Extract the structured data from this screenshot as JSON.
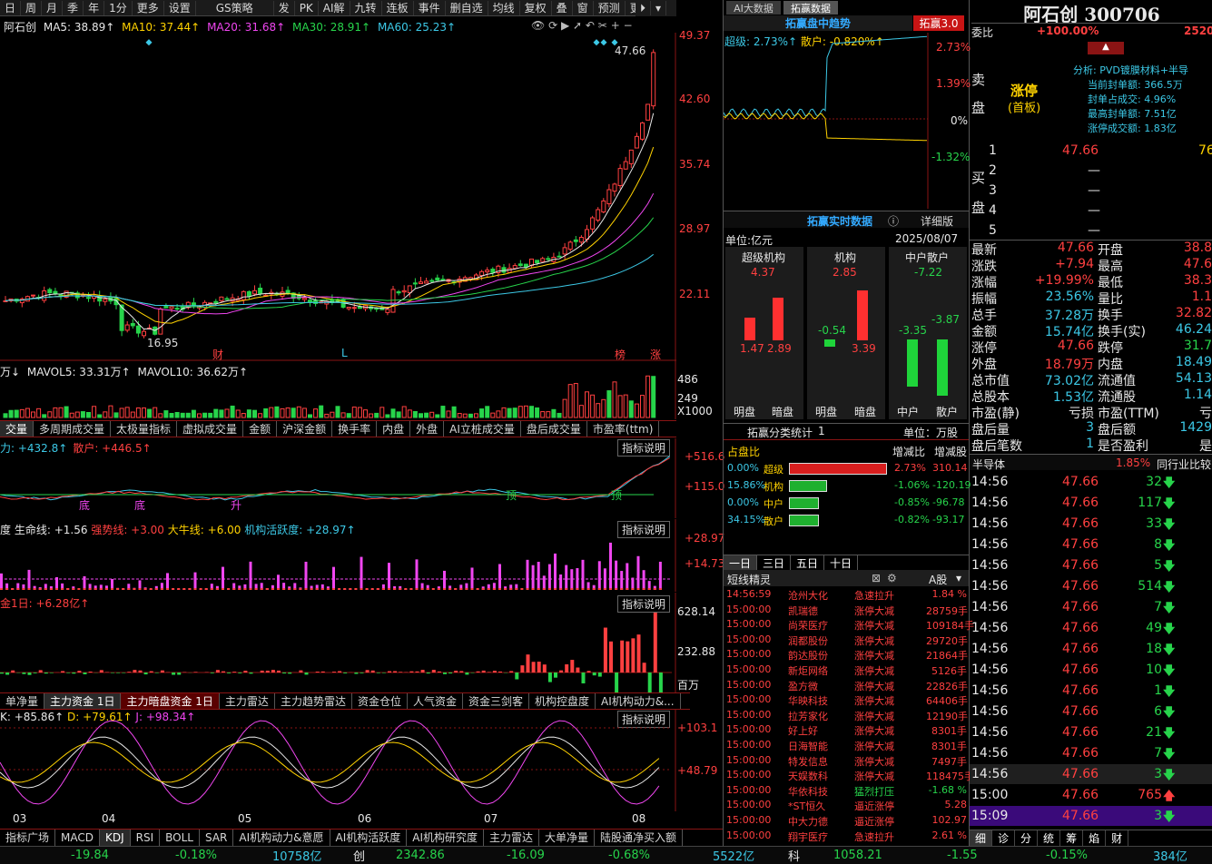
{
  "toolbar": {
    "items": [
      "日",
      "周",
      "月",
      "季",
      "年",
      "1分",
      "更多",
      "设置",
      "GS策略",
      "发",
      "PK",
      "AI解",
      "九转",
      "连板",
      "事件",
      "删自选",
      "均线",
      "复权",
      "叠",
      "窗",
      "预测",
      "更多"
    ]
  },
  "ma_line": {
    "name": "阿石创",
    "ma5": "MA5: 38.89↑",
    "ma10": "MA10: 37.44↑",
    "ma20": "MA20: 31.68↑",
    "ma30": "MA30: 28.91↑",
    "ma60": "MA60: 25.23↑"
  },
  "price_axis": [
    "49.37",
    "42.60",
    "35.74",
    "28.97",
    "22.11"
  ],
  "price_marks": {
    "high": "47.66",
    "low": "16.95",
    "marks": [
      "财",
      "L",
      "榜",
      "涨"
    ]
  },
  "vol": {
    "title": "万↓",
    "mavol5": "MAVOL5: 33.31万↑",
    "mavol10": "MAVOL10: 36.62万↑",
    "axis": [
      "486",
      "249",
      "X1000"
    ]
  },
  "tabs1": [
    "交量",
    "多周期成交量",
    "太极量指标",
    "虚拟成交量",
    "金额",
    "沪深金额",
    "换手率",
    "内盘",
    "外盘",
    "AI立桩成交量",
    "盘后成交量",
    "市盈率(ttm)"
  ],
  "ind1": {
    "text_a": "力: +432.8↑",
    "text_b": "散户: +446.5↑",
    "btn": "指标说明",
    "axis": [
      "+516.6",
      "+115.0"
    ],
    "marks": [
      "底",
      "底",
      "升",
      "顶",
      "顶"
    ]
  },
  "ind2": {
    "label_a": "度",
    "label_b": "生命线: +1.56",
    "label_c": "强势线: +3.00",
    "label_d": "大牛线: +6.00",
    "label_e": "机构活跃度: +28.97↑",
    "btn": "指标说明",
    "axis": [
      "+28.97",
      "+14.73"
    ]
  },
  "ind3": {
    "label": "金1日: +6.28亿↑",
    "btn": "指标说明",
    "axis": [
      "628.14",
      "232.88",
      "百万"
    ]
  },
  "tabs2": [
    "单净量",
    "主力资金 1日",
    "主力暗盘资金 1日",
    "主力雷达",
    "主力趋势雷达",
    "资金仓位",
    "人气资金",
    "资金三剑客",
    "机构控盘度",
    "AI机构动力&..."
  ],
  "kdj": {
    "k": "K: +85.86↑",
    "d": "D: +79.61↑",
    "j": "J: +98.34↑",
    "btn": "指标说明",
    "axis": [
      "+103.1",
      "+48.79"
    ]
  },
  "months": [
    "03",
    "04",
    "05",
    "06",
    "07",
    "08"
  ],
  "tabs3": [
    "指标广场",
    "MACD",
    "KDJ",
    "RSI",
    "BOLL",
    "SAR",
    "AI机构动力&意愿",
    "AI机构活跃度",
    "AI机构研究度",
    "主力雷达",
    "大单净量",
    "陆股通净买入额"
  ],
  "status": {
    "v1": "-19.84",
    "v2": "-0.18%",
    "v3": "10758亿",
    "chuang": "创",
    "c1": "2342.86",
    "c2": "-16.09",
    "c3": "-0.68%",
    "c4": "5522亿",
    "ke": "科",
    "k1": "1058.21",
    "k2": "-1.55",
    "k3": "-0.15%",
    "k4": "384亿"
  },
  "mid": {
    "tab1": "AI大数据",
    "tab2": "拓赢数据",
    "title": "拓赢盘中趋势",
    "badge": "拓赢3.0",
    "super": "超级: 2.73%↑",
    "retail": "散户: -0.820%↑",
    "axis": [
      "2.73%",
      "1.39%",
      "0%",
      "-1.32%"
    ],
    "rt_title": "拓赢实时数据",
    "detail": "详细版",
    "unit": "单位:亿元",
    "date": "2025/08/07",
    "groups": [
      {
        "name": "超级机构",
        "total": "4.37",
        "a": "1.47",
        "b": "2.89"
      },
      {
        "name": "机构",
        "total": "2.85",
        "a": "-0.54",
        "b": "3.39"
      },
      {
        "name": "中户散户",
        "total": "-7.22",
        "a": "-3.35",
        "b": "-3.87"
      }
    ],
    "bar_labels": [
      "明盘",
      "暗盘",
      "明盘",
      "暗盘",
      "中户",
      "散户"
    ],
    "cls_title": "拓赢分类统计",
    "cls_n": "1",
    "cls_unit": "单位：万股",
    "cls_head": [
      "占盘比",
      "增减比",
      "增减股"
    ],
    "cls": [
      {
        "p": "0.00%",
        "n": "超级",
        "r": "2.73%",
        "v": "310.14"
      },
      {
        "p": "15.86%",
        "n": "机构",
        "r": "-1.06%",
        "v": "-120.19"
      },
      {
        "p": "0.00%",
        "n": "中户",
        "r": "-0.85%",
        "v": "-96.78"
      },
      {
        "p": "34.15%",
        "n": "散户",
        "r": "-0.82%",
        "v": "-93.17"
      }
    ],
    "day_tabs": [
      "一日",
      "三日",
      "五日",
      "十日"
    ],
    "jl_title": "短线精灵",
    "jl_mkt": "A股",
    "jl": [
      [
        "14:56:59",
        "沧州大化",
        "急速拉升",
        "1.84 %"
      ],
      [
        "15:00:00",
        "凯瑞德",
        "涨停大减",
        "28759手"
      ],
      [
        "15:00:00",
        "尚荣医疗",
        "涨停大减",
        "109184手"
      ],
      [
        "15:00:00",
        "润都股份",
        "涨停大减",
        "29720手"
      ],
      [
        "15:00:00",
        "韵达股份",
        "涨停大减",
        "21864手"
      ],
      [
        "15:00:00",
        "新炬网络",
        "涨停大减",
        "5126手"
      ],
      [
        "15:00:00",
        "盈方微",
        "涨停大减",
        "22826手"
      ],
      [
        "15:00:00",
        "华映科技",
        "涨停大减",
        "64406手"
      ],
      [
        "15:00:00",
        "拉芳家化",
        "涨停大减",
        "12190手"
      ],
      [
        "15:00:00",
        "好上好",
        "涨停大减",
        "8301手"
      ],
      [
        "15:00:00",
        "日海智能",
        "涨停大减",
        "8301手"
      ],
      [
        "15:00:00",
        "特发信息",
        "涨停大减",
        "7497手"
      ],
      [
        "15:00:00",
        "天娱数科",
        "涨停大减",
        "118475手"
      ],
      [
        "15:00:00",
        "华依科技",
        "猛烈打压",
        "-1.68 %"
      ],
      [
        "15:00:00",
        "*ST恒久",
        "逼近涨停",
        "5.28"
      ],
      [
        "15:00:00",
        "中大力德",
        "逼近涨停",
        "102.97"
      ],
      [
        "15:00:00",
        "翔宇医疗",
        "急速拉升",
        "2.61 %"
      ]
    ]
  },
  "right": {
    "title": "阿石创 300706",
    "weibi": "委比",
    "weibi_v": "+100.00%",
    "weibi_n": "2520",
    "sell": "卖",
    "pan": "盘",
    "buy": "买",
    "pan2": "盘",
    "limit": "涨停",
    "limit2": "(首板)",
    "analysis": "分析: PVD镀膜材料+半导",
    "a1": "当前封单额: 366.5万",
    "a2": "封单占成交: 4.96%",
    "a3": "最高封单额: 7.51亿",
    "a4": "涨停成交额: 1.83亿",
    "bids": [
      [
        "1",
        "47.66",
        "76"
      ],
      [
        "2",
        "—",
        ""
      ],
      [
        "3",
        "—",
        ""
      ],
      [
        "4",
        "—",
        ""
      ],
      [
        "5",
        "—",
        ""
      ]
    ],
    "stats": [
      [
        "最新",
        "47.66",
        "开盘",
        "38.8"
      ],
      [
        "涨跌",
        "+7.94",
        "最高",
        "47.6"
      ],
      [
        "涨幅",
        "+19.99%",
        "最低",
        "38.3"
      ],
      [
        "振幅",
        "23.56%",
        "量比",
        "1.1"
      ],
      [
        "总手",
        "37.28万",
        "换手",
        "32.82"
      ],
      [
        "金额",
        "15.74亿",
        "换手(实)",
        "46.24"
      ],
      [
        "涨停",
        "47.66",
        "跌停",
        "31.7"
      ],
      [
        "外盘",
        "18.79万",
        "内盘",
        "18.49"
      ],
      [
        "总市值",
        "73.02亿",
        "流通值",
        "54.13"
      ],
      [
        "总股本",
        "1.53亿",
        "流通股",
        "1.14"
      ],
      [
        "市盈(静)",
        "亏损",
        "市盈(TTM)",
        "亏"
      ],
      [
        "盘后量",
        "3",
        "盘后额",
        "1429"
      ],
      [
        "盘后笔数",
        "1",
        "是否盈利",
        "是"
      ]
    ],
    "sector": "半导体",
    "sector_v": "1.85%",
    "sector_cmp": "同行业比较",
    "ticks": [
      [
        "14:56",
        "47.66",
        "32",
        "d"
      ],
      [
        "14:56",
        "47.66",
        "117",
        "d"
      ],
      [
        "14:56",
        "47.66",
        "33",
        "d"
      ],
      [
        "14:56",
        "47.66",
        "8",
        "d"
      ],
      [
        "14:56",
        "47.66",
        "5",
        "d"
      ],
      [
        "14:56",
        "47.66",
        "514",
        "d"
      ],
      [
        "14:56",
        "47.66",
        "7",
        "d"
      ],
      [
        "14:56",
        "47.66",
        "49",
        "d"
      ],
      [
        "14:56",
        "47.66",
        "18",
        "d"
      ],
      [
        "14:56",
        "47.66",
        "10",
        "d"
      ],
      [
        "14:56",
        "47.66",
        "1",
        "d"
      ],
      [
        "14:56",
        "47.66",
        "6",
        "d"
      ],
      [
        "14:56",
        "47.66",
        "21",
        "d"
      ],
      [
        "14:56",
        "47.66",
        "7",
        "d"
      ],
      [
        "14:56",
        "47.66",
        "3",
        "d"
      ],
      [
        "15:00",
        "47.66",
        "765",
        "u"
      ],
      [
        "15:09",
        "47.66",
        "3",
        "d"
      ]
    ],
    "btabs": [
      "细",
      "诊",
      "分",
      "统",
      "筹",
      "焰",
      "财"
    ]
  },
  "colors": {
    "up": "#ff4040",
    "down": "#27d44b",
    "axis": "#8a1414",
    "yellow": "#ffd200"
  }
}
